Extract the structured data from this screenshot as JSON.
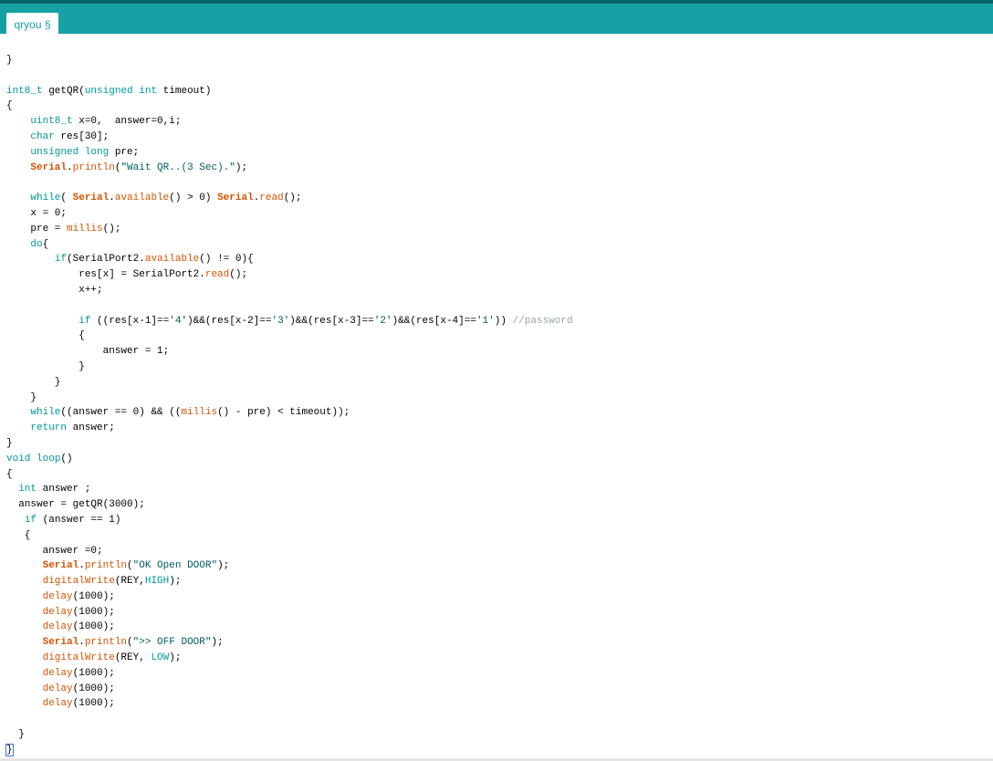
{
  "tab": {
    "label": "qryou §"
  },
  "colors": {
    "topbar": "#17a1a5",
    "topbar_border": "#006468",
    "keyword": "#00979c",
    "function": "#d35400",
    "string": "#005c5f",
    "comment": "#95a5a6",
    "plain": "#000000"
  },
  "code": {
    "lines": [
      [
        {
          "t": "}"
        }
      ],
      [],
      [
        {
          "t": "int8_t",
          "c": "k"
        },
        {
          "t": " getQR("
        },
        {
          "t": "unsigned",
          "c": "k"
        },
        {
          "t": " "
        },
        {
          "t": "int",
          "c": "k"
        },
        {
          "t": " timeout)"
        }
      ],
      [
        {
          "t": "{"
        }
      ],
      [
        {
          "t": "    "
        },
        {
          "t": "uint8_t",
          "c": "k"
        },
        {
          "t": " x=0,  answer=0,i;"
        }
      ],
      [
        {
          "t": "    "
        },
        {
          "t": "char",
          "c": "k"
        },
        {
          "t": " res[30];"
        }
      ],
      [
        {
          "t": "    "
        },
        {
          "t": "unsigned",
          "c": "k"
        },
        {
          "t": " "
        },
        {
          "t": "long",
          "c": "k"
        },
        {
          "t": " pre;"
        }
      ],
      [
        {
          "t": "    "
        },
        {
          "t": "Serial",
          "c": "fb"
        },
        {
          "t": "."
        },
        {
          "t": "println",
          "c": "f"
        },
        {
          "t": "("
        },
        {
          "t": "\"Wait QR..(3 Sec).\"",
          "c": "s"
        },
        {
          "t": ");"
        }
      ],
      [],
      [
        {
          "t": "    "
        },
        {
          "t": "while",
          "c": "k"
        },
        {
          "t": "( "
        },
        {
          "t": "Serial",
          "c": "fb"
        },
        {
          "t": "."
        },
        {
          "t": "available",
          "c": "f"
        },
        {
          "t": "() > 0) "
        },
        {
          "t": "Serial",
          "c": "fb"
        },
        {
          "t": "."
        },
        {
          "t": "read",
          "c": "f"
        },
        {
          "t": "();"
        }
      ],
      [
        {
          "t": "    x = 0;"
        }
      ],
      [
        {
          "t": "    pre = "
        },
        {
          "t": "millis",
          "c": "f"
        },
        {
          "t": "();"
        }
      ],
      [
        {
          "t": "    "
        },
        {
          "t": "do",
          "c": "k"
        },
        {
          "t": "{"
        }
      ],
      [
        {
          "t": "        "
        },
        {
          "t": "if",
          "c": "k"
        },
        {
          "t": "(SerialPort2."
        },
        {
          "t": "available",
          "c": "f"
        },
        {
          "t": "() != 0){"
        }
      ],
      [
        {
          "t": "            res[x] = SerialPort2."
        },
        {
          "t": "read",
          "c": "f"
        },
        {
          "t": "();"
        }
      ],
      [
        {
          "t": "            x++;"
        }
      ],
      [],
      [
        {
          "t": "            "
        },
        {
          "t": "if",
          "c": "k"
        },
        {
          "t": " ((res[x-1]=="
        },
        {
          "t": "'4'",
          "c": "s"
        },
        {
          "t": ")&&(res[x-2]=="
        },
        {
          "t": "'3'",
          "c": "s"
        },
        {
          "t": ")&&(res[x-3]=="
        },
        {
          "t": "'2'",
          "c": "s"
        },
        {
          "t": ")&&(res[x-4]=="
        },
        {
          "t": "'1'",
          "c": "s"
        },
        {
          "t": ")) "
        },
        {
          "t": "//password",
          "c": "c"
        }
      ],
      [
        {
          "t": "            {"
        }
      ],
      [
        {
          "t": "                answer = 1;"
        }
      ],
      [
        {
          "t": "            }"
        }
      ],
      [
        {
          "t": "        }"
        }
      ],
      [
        {
          "t": "    }"
        }
      ],
      [
        {
          "t": "    "
        },
        {
          "t": "while",
          "c": "k"
        },
        {
          "t": "((answer == 0) && (("
        },
        {
          "t": "millis",
          "c": "f"
        },
        {
          "t": "() - pre) < timeout));"
        }
      ],
      [
        {
          "t": "    "
        },
        {
          "t": "return",
          "c": "k"
        },
        {
          "t": " answer;"
        }
      ],
      [
        {
          "t": "}"
        }
      ],
      [
        {
          "t": "void",
          "c": "k"
        },
        {
          "t": " "
        },
        {
          "t": "loop",
          "c": "k"
        },
        {
          "t": "()"
        }
      ],
      [
        {
          "t": "{"
        }
      ],
      [
        {
          "t": "  "
        },
        {
          "t": "int",
          "c": "k"
        },
        {
          "t": " answer ;"
        }
      ],
      [
        {
          "t": "  answer = getQR(3000);"
        }
      ],
      [
        {
          "t": "   "
        },
        {
          "t": "if",
          "c": "k"
        },
        {
          "t": " (answer == 1)"
        }
      ],
      [
        {
          "t": "   {"
        }
      ],
      [
        {
          "t": "      answer =0;"
        }
      ],
      [
        {
          "t": "      "
        },
        {
          "t": "Serial",
          "c": "fb"
        },
        {
          "t": "."
        },
        {
          "t": "println",
          "c": "f"
        },
        {
          "t": "("
        },
        {
          "t": "\"OK Open DOOR\"",
          "c": "s"
        },
        {
          "t": ");"
        }
      ],
      [
        {
          "t": "      "
        },
        {
          "t": "digitalWrite",
          "c": "f"
        },
        {
          "t": "(REY,"
        },
        {
          "t": "HIGH",
          "c": "k"
        },
        {
          "t": ");"
        }
      ],
      [
        {
          "t": "      "
        },
        {
          "t": "delay",
          "c": "f"
        },
        {
          "t": "(1000);"
        }
      ],
      [
        {
          "t": "      "
        },
        {
          "t": "delay",
          "c": "f"
        },
        {
          "t": "(1000);"
        }
      ],
      [
        {
          "t": "      "
        },
        {
          "t": "delay",
          "c": "f"
        },
        {
          "t": "(1000);"
        }
      ],
      [
        {
          "t": "      "
        },
        {
          "t": "Serial",
          "c": "fb"
        },
        {
          "t": "."
        },
        {
          "t": "println",
          "c": "f"
        },
        {
          "t": "("
        },
        {
          "t": "\">> OFF DOOR\"",
          "c": "s"
        },
        {
          "t": ");"
        }
      ],
      [
        {
          "t": "      "
        },
        {
          "t": "digitalWrite",
          "c": "f"
        },
        {
          "t": "(REY, "
        },
        {
          "t": "LOW",
          "c": "k"
        },
        {
          "t": ");"
        }
      ],
      [
        {
          "t": "      "
        },
        {
          "t": "delay",
          "c": "f"
        },
        {
          "t": "(1000);"
        }
      ],
      [
        {
          "t": "      "
        },
        {
          "t": "delay",
          "c": "f"
        },
        {
          "t": "(1000);"
        }
      ],
      [
        {
          "t": "      "
        },
        {
          "t": "delay",
          "c": "f"
        },
        {
          "t": "(1000);"
        }
      ],
      [],
      [
        {
          "t": "  }"
        }
      ],
      [
        {
          "t": "}",
          "c": "cursor"
        }
      ]
    ]
  }
}
